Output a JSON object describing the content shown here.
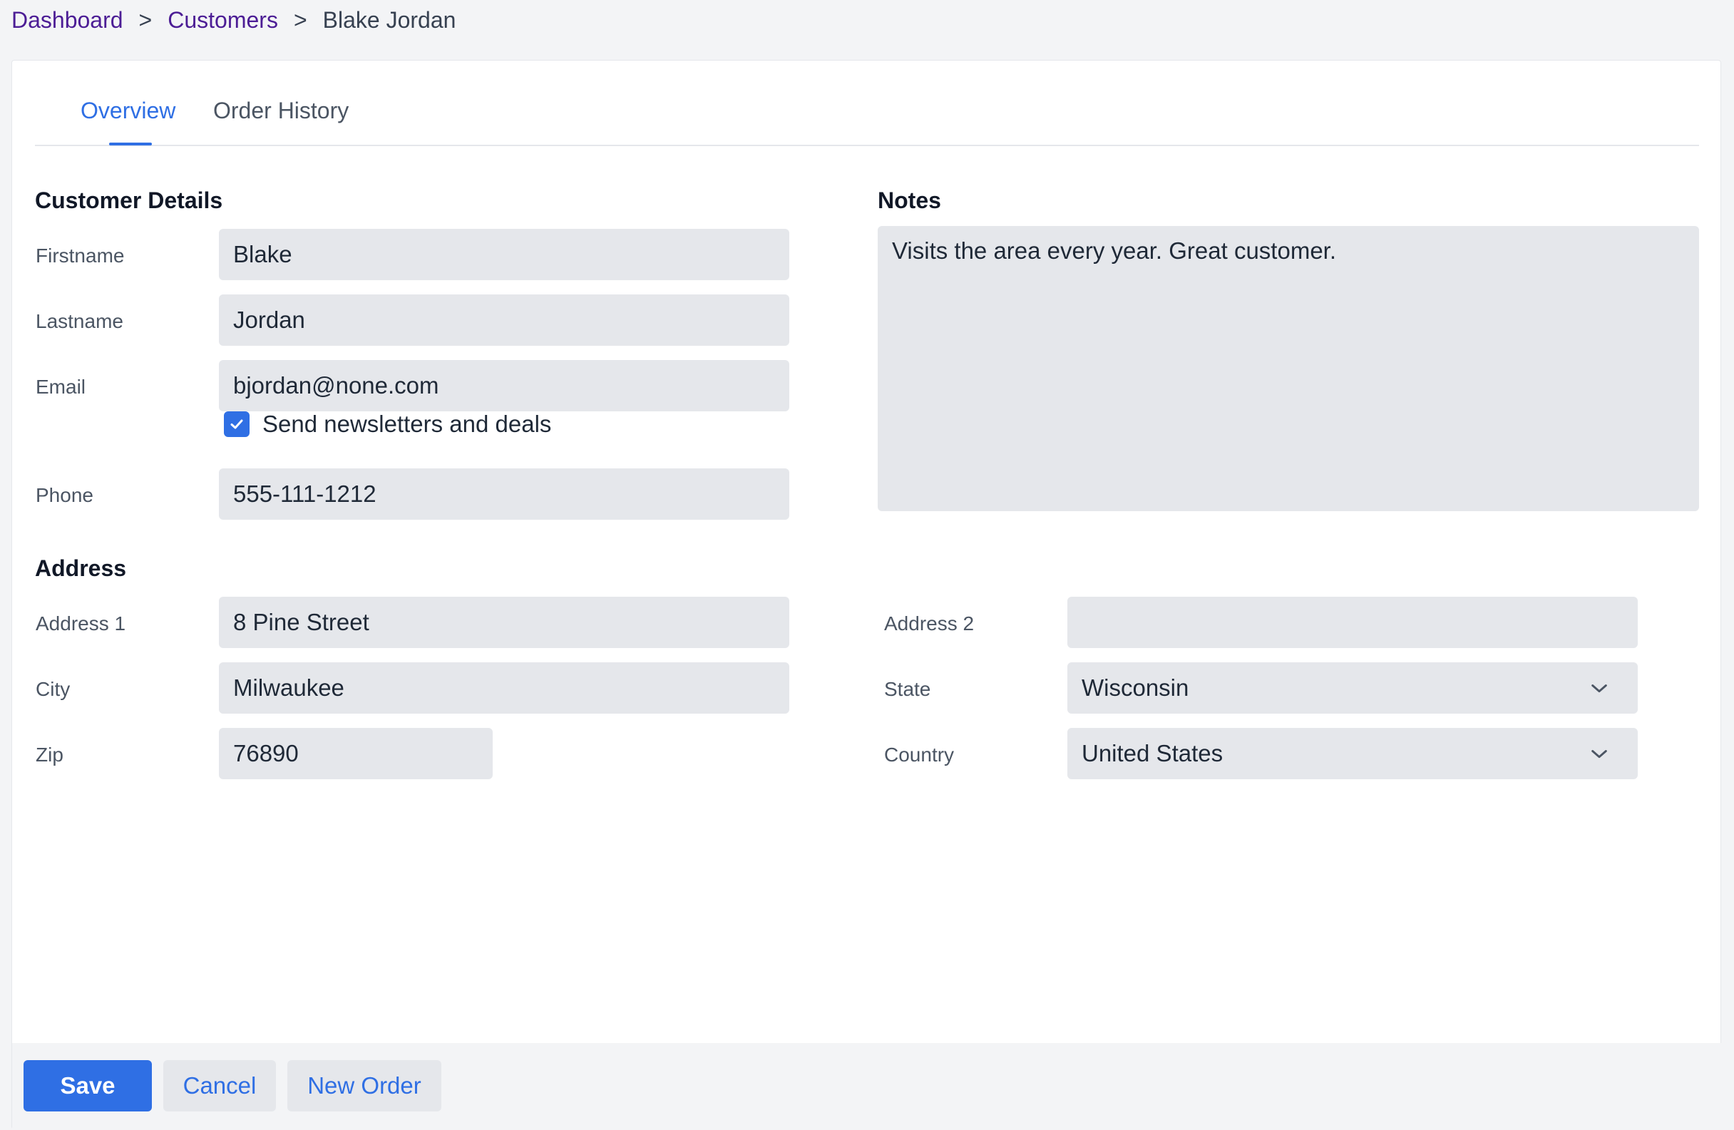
{
  "breadcrumb": {
    "items": [
      "Dashboard",
      "Customers"
    ],
    "current": "Blake Jordan",
    "separator": ">"
  },
  "tabs": [
    {
      "label": "Overview",
      "active": true
    },
    {
      "label": "Order History",
      "active": false
    }
  ],
  "customer_details": {
    "title": "Customer Details",
    "firstname": {
      "label": "Firstname",
      "value": "Blake"
    },
    "lastname": {
      "label": "Lastname",
      "value": "Jordan"
    },
    "email": {
      "label": "Email",
      "value": "bjordan@none.com"
    },
    "newsletter": {
      "label": "Send newsletters and deals",
      "checked": true
    },
    "phone": {
      "label": "Phone",
      "value": "555-111-1212"
    }
  },
  "notes": {
    "title": "Notes",
    "value": "Visits the area every year. Great customer."
  },
  "address": {
    "title": "Address",
    "address1": {
      "label": "Address 1",
      "value": "8 Pine Street"
    },
    "address2": {
      "label": "Address 2",
      "value": ""
    },
    "city": {
      "label": "City",
      "value": "Milwaukee"
    },
    "state": {
      "label": "State",
      "value": "Wisconsin"
    },
    "zip": {
      "label": "Zip",
      "value": "76890"
    },
    "country": {
      "label": "Country",
      "value": "United States"
    }
  },
  "footer": {
    "save_label": "Save",
    "cancel_label": "Cancel",
    "new_order_label": "New Order"
  },
  "colors": {
    "accent": "#2f6fe4",
    "breadcrumb_link": "#4c1d95",
    "field_bg": "#e5e7eb"
  },
  "icons": {
    "checkbox": "check-icon",
    "select": "chevron-down-icon"
  }
}
